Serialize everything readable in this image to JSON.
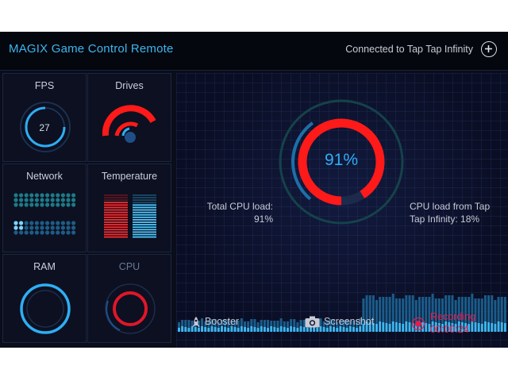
{
  "header": {
    "title": "MAGIX Game Control Remote",
    "connection_text": "Connected to Tap Tap Infinity",
    "add_icon": "plus-circle-icon"
  },
  "tiles": {
    "fps": {
      "label": "FPS",
      "value": "27"
    },
    "drives": {
      "label": "Drives"
    },
    "network": {
      "label": "Network"
    },
    "temperature": {
      "label": "Temperature"
    },
    "ram": {
      "label": "RAM"
    },
    "cpu": {
      "label": "CPU"
    }
  },
  "cpu": {
    "percent": 91,
    "percent_text": "91%",
    "total_label": "Total CPU load:",
    "total_value": "91%",
    "app_label_line1": "CPU load from Tap",
    "app_label_line2": "Tap Infinity: 18%",
    "app_fraction": 0.18
  },
  "bottom": {
    "booster": "Booster",
    "screenshot": "Screenshot",
    "recording": "Recording",
    "recording_time": "00:00:24"
  },
  "colors": {
    "accent_blue": "#2eaef5",
    "accent_red": "#ff1a1a",
    "recording_red": "#e61b4e",
    "background": "#0a0d1a"
  }
}
